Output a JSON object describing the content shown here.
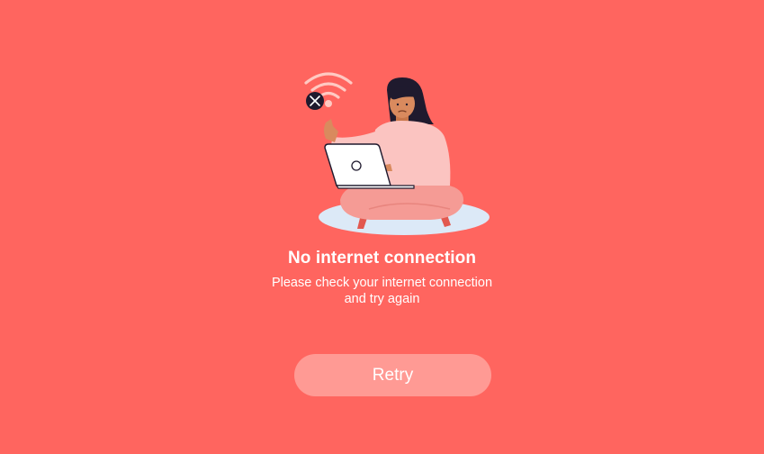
{
  "offline_screen": {
    "title": "No internet connection",
    "message_line1": "Please check your internet connection",
    "message_line2": "and try again",
    "retry_label": "Retry"
  },
  "illustration": {
    "icons": [
      "wifi-icon",
      "close-icon",
      "laptop-icon"
    ]
  },
  "colors": {
    "background": "#FF655F",
    "button": "#FF9A94",
    "text": "#FFFFFF",
    "skin": "#D98A5E",
    "hair": "#1F1A2E",
    "shirt": "#FBC4C1",
    "pants": "#F59B95",
    "cushion": "#DCE9F7"
  }
}
